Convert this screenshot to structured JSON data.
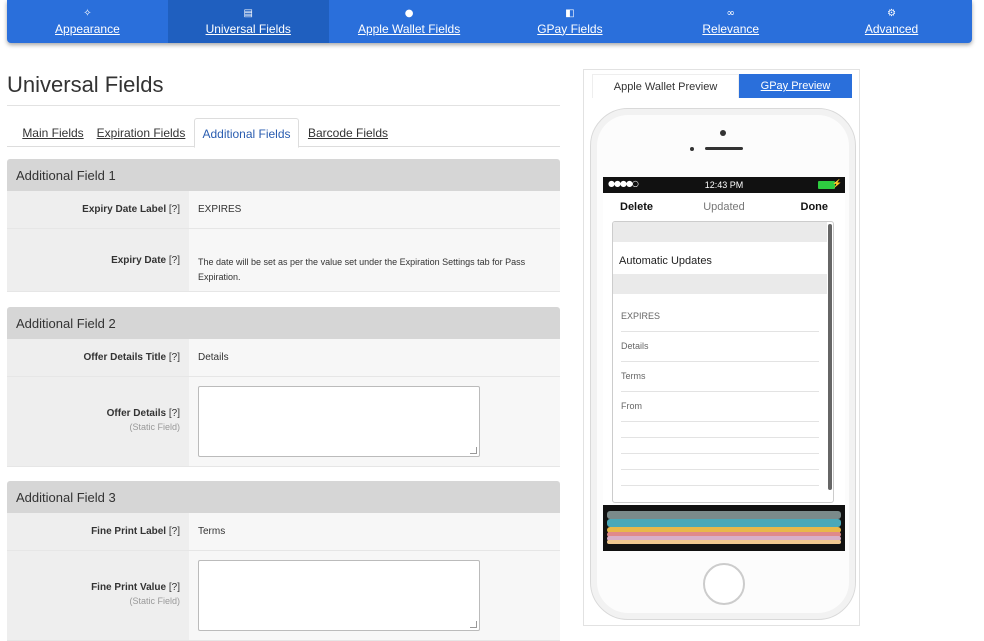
{
  "nav": {
    "items": [
      {
        "label": "Appearance",
        "icon": "magic-wand-icon",
        "glyph": "✧",
        "active": false
      },
      {
        "label": "Universal Fields",
        "icon": "document-icon",
        "glyph": "▤",
        "active": true
      },
      {
        "label": "Apple Wallet Fields",
        "icon": "apple-icon",
        "glyph": "●",
        "active": false
      },
      {
        "label": "GPay Fields",
        "icon": "wallet-icon",
        "glyph": "◧",
        "active": false
      },
      {
        "label": "Relevance",
        "icon": "link-icon",
        "glyph": "∞",
        "active": false
      },
      {
        "label": "Advanced",
        "icon": "cogs-icon",
        "glyph": "⚙",
        "active": false
      }
    ]
  },
  "page": {
    "title": "Universal Fields"
  },
  "tabs": [
    "Main Fields",
    "Expiration Fields",
    "Additional Fields",
    "Barcode Fields"
  ],
  "sections": [
    {
      "title": "Additional Field 1",
      "rows": [
        {
          "label": "Expiry Date Label",
          "help": "[?]",
          "value": "EXPIRES"
        },
        {
          "label": "Expiry Date",
          "help": "[?]",
          "value_line1": "The date will be set as per the value set under the Expiration Settings tab for Pass",
          "value_line2": "Expiration."
        }
      ]
    },
    {
      "title": "Additional Field 2",
      "rows": [
        {
          "label": "Offer Details Title",
          "help": "[?]",
          "value": "Details"
        },
        {
          "label": "Offer Details",
          "help": "[?]",
          "sub": "(Static Field)",
          "input_value": ""
        }
      ]
    },
    {
      "title": "Additional Field 3",
      "rows": [
        {
          "label": "Fine Print Label",
          "help": "[?]",
          "value": "Terms"
        },
        {
          "label": "Fine Print Value",
          "help": "[?]",
          "sub": "(Static Field)",
          "input_value": ""
        }
      ]
    }
  ],
  "preview": {
    "tabs": {
      "apple": "Apple Wallet Preview",
      "gpay": "GPay Preview"
    },
    "phone": {
      "status_time": "12:43 PM",
      "signal": "●●●●○",
      "battery_bolt": "⚡",
      "actions": {
        "delete": "Delete",
        "updated": "Updated",
        "done": "Done"
      },
      "automatic_updates": "Automatic Updates",
      "fields": [
        "EXPIRES",
        "Details",
        "Terms",
        "From"
      ]
    }
  },
  "colors": {
    "nav_bg": "#2a6fdb",
    "nav_active": "#1f5fbf",
    "section_head": "#d6d6d6",
    "battery": "#2ecc40"
  }
}
